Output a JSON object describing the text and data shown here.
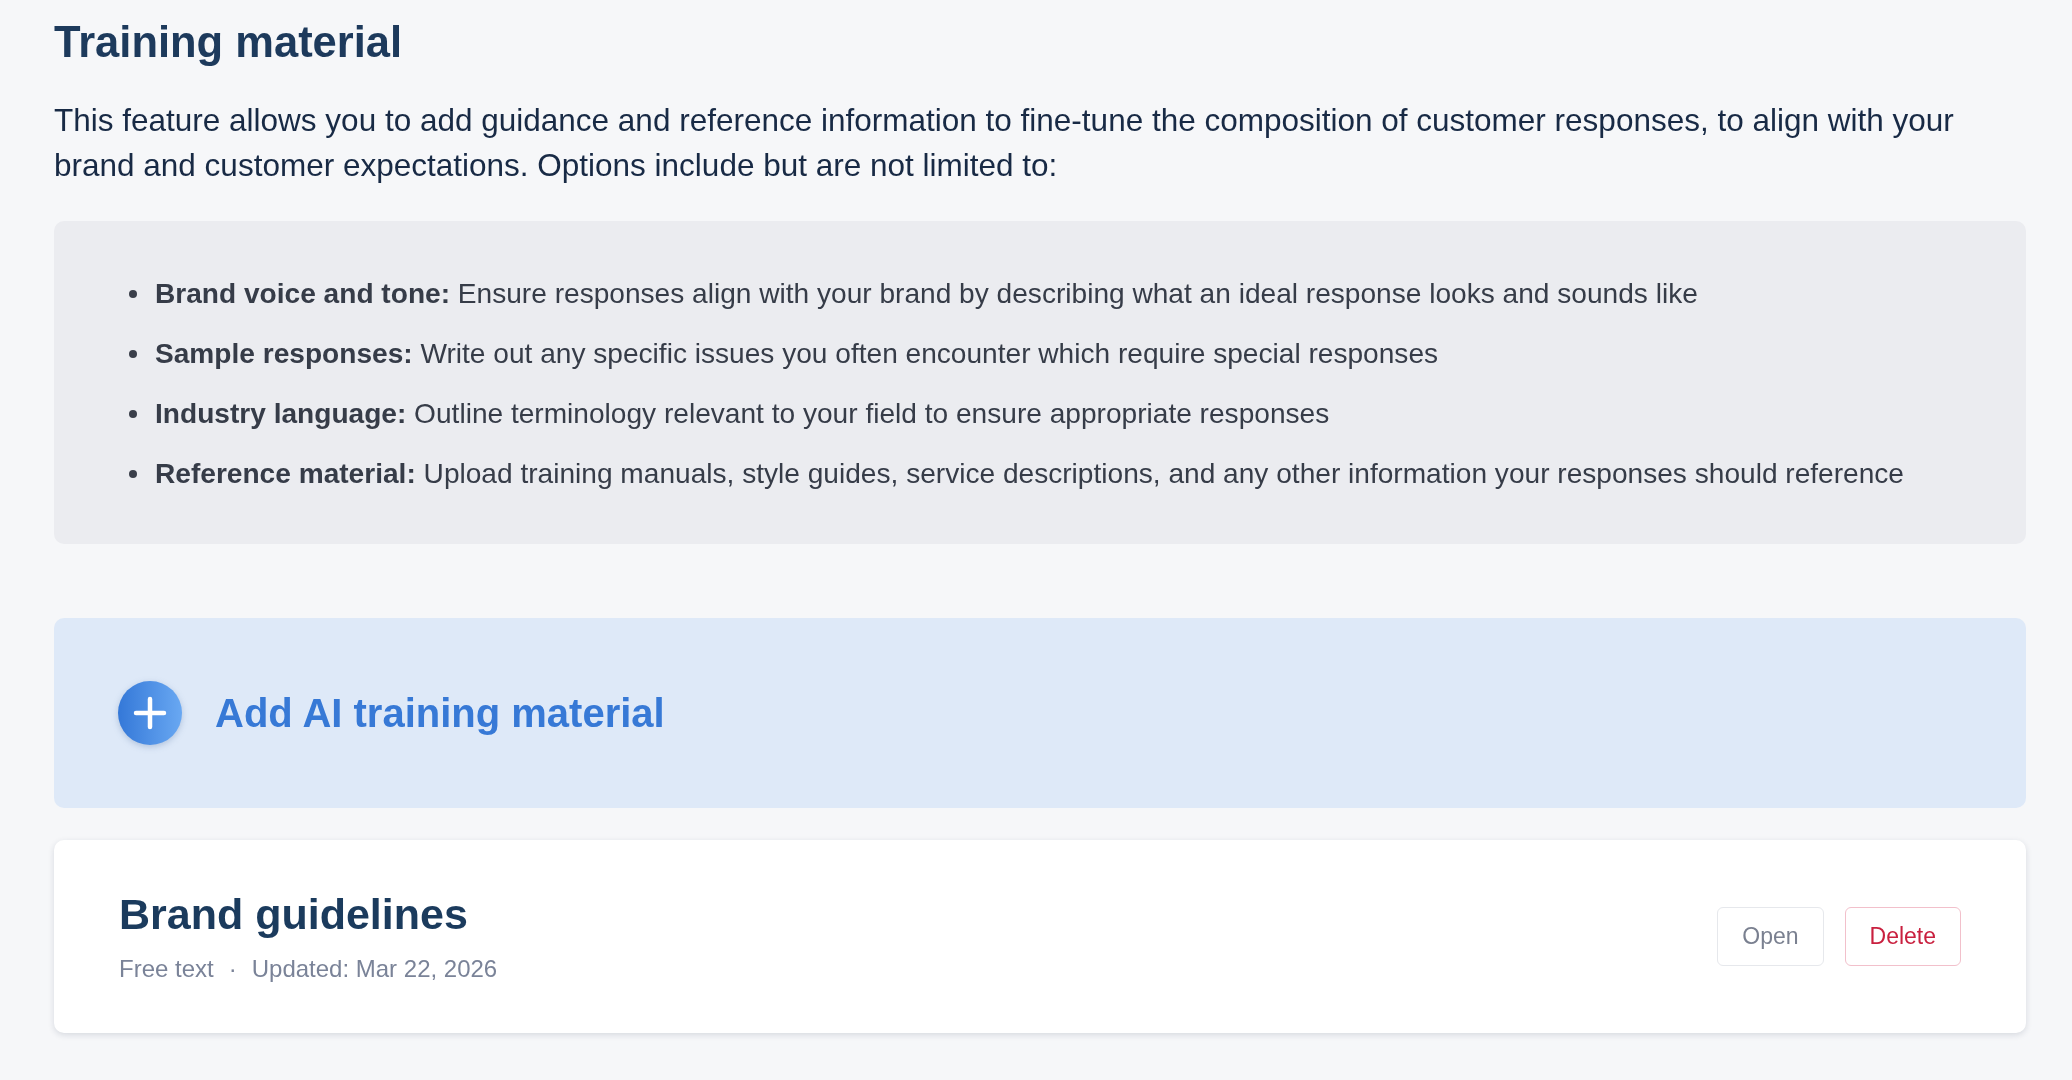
{
  "page": {
    "title": "Training material",
    "intro": "This feature allows you to add guidance and reference information to fine-tune the composition of customer responses, to align with your brand and customer expectations. Options include but are not limited to:"
  },
  "options": [
    "**Brand voice and tone:** Ensure responses align with your brand by describing what an ideal response looks and sounds like",
    "**Sample responses:** Write out any specific issues you often encounter which require special responses",
    "**Industry language:** Outline terminology relevant to your field to ensure appropriate responses",
    "**Reference material:** Upload training manuals, style guides, service descriptions, and any other information your responses should reference"
  ],
  "add_button": {
    "label": "Add AI training material"
  },
  "materials": [
    {
      "title": "Brand guidelines",
      "type": "Free text",
      "separator": "·",
      "updated": "Updated: Mar 22, 2026",
      "actions": [
        {
          "label": "Open",
          "kind": "neutral"
        },
        {
          "label": "Delete",
          "kind": "danger"
        }
      ]
    }
  ]
}
